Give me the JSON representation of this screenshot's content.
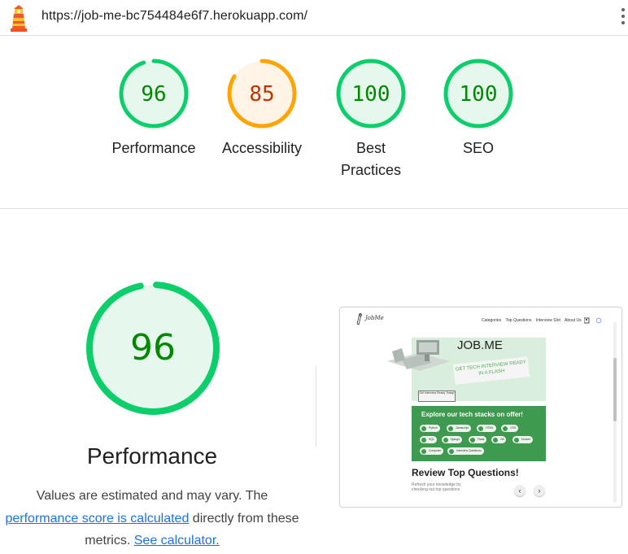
{
  "url": "https://job-me-bc754484e6f7.herokuapp.com/",
  "summary": [
    {
      "label": "Performance",
      "score": "96",
      "value": 0.96,
      "color": "#0cce6b",
      "text_color": "#008800",
      "bg": "#e6f7ee"
    },
    {
      "label": "Accessibility",
      "score": "85",
      "value": 0.85,
      "color": "#ffa400",
      "text_color": "#c33300",
      "bg": "#fff4e5"
    },
    {
      "label": "Best Practices",
      "score": "100",
      "value": 1.0,
      "color": "#0cce6b",
      "text_color": "#008800",
      "bg": "#e6f7ee"
    },
    {
      "label": "SEO",
      "score": "100",
      "value": 1.0,
      "color": "#0cce6b",
      "text_color": "#008800",
      "bg": "#e6f7ee"
    }
  ],
  "performance": {
    "score": "96",
    "value": 0.96,
    "title": "Performance",
    "desc_prefix": "Values are estimated and may vary. The ",
    "desc_link1": "performance score is calculated",
    "desc_middle": " directly from these metrics. ",
    "desc_link2": "See calculator."
  },
  "thumbnail": {
    "logo": "JobMe",
    "nav_links": [
      "Categories",
      "Top Questions",
      "Interview Slot",
      "About Us"
    ],
    "hero_title": "JOB.ME",
    "hero_subtitle": "GET TECH INTERVIEW READY IN A FLASH",
    "hero_button": "Get Interview Ready Today!",
    "stacks_title": "Explore our tech stacks on offer!",
    "stacks": [
      "Python",
      "Javascript",
      "HTML",
      "CSS",
      "SQL",
      "Django",
      "Flask",
      "Git",
      "Docker",
      "Computer",
      "Interview Questions"
    ],
    "review_title": "Review Top Questions!",
    "review_sub": "Refresh your knowledge by checking out top questions"
  }
}
